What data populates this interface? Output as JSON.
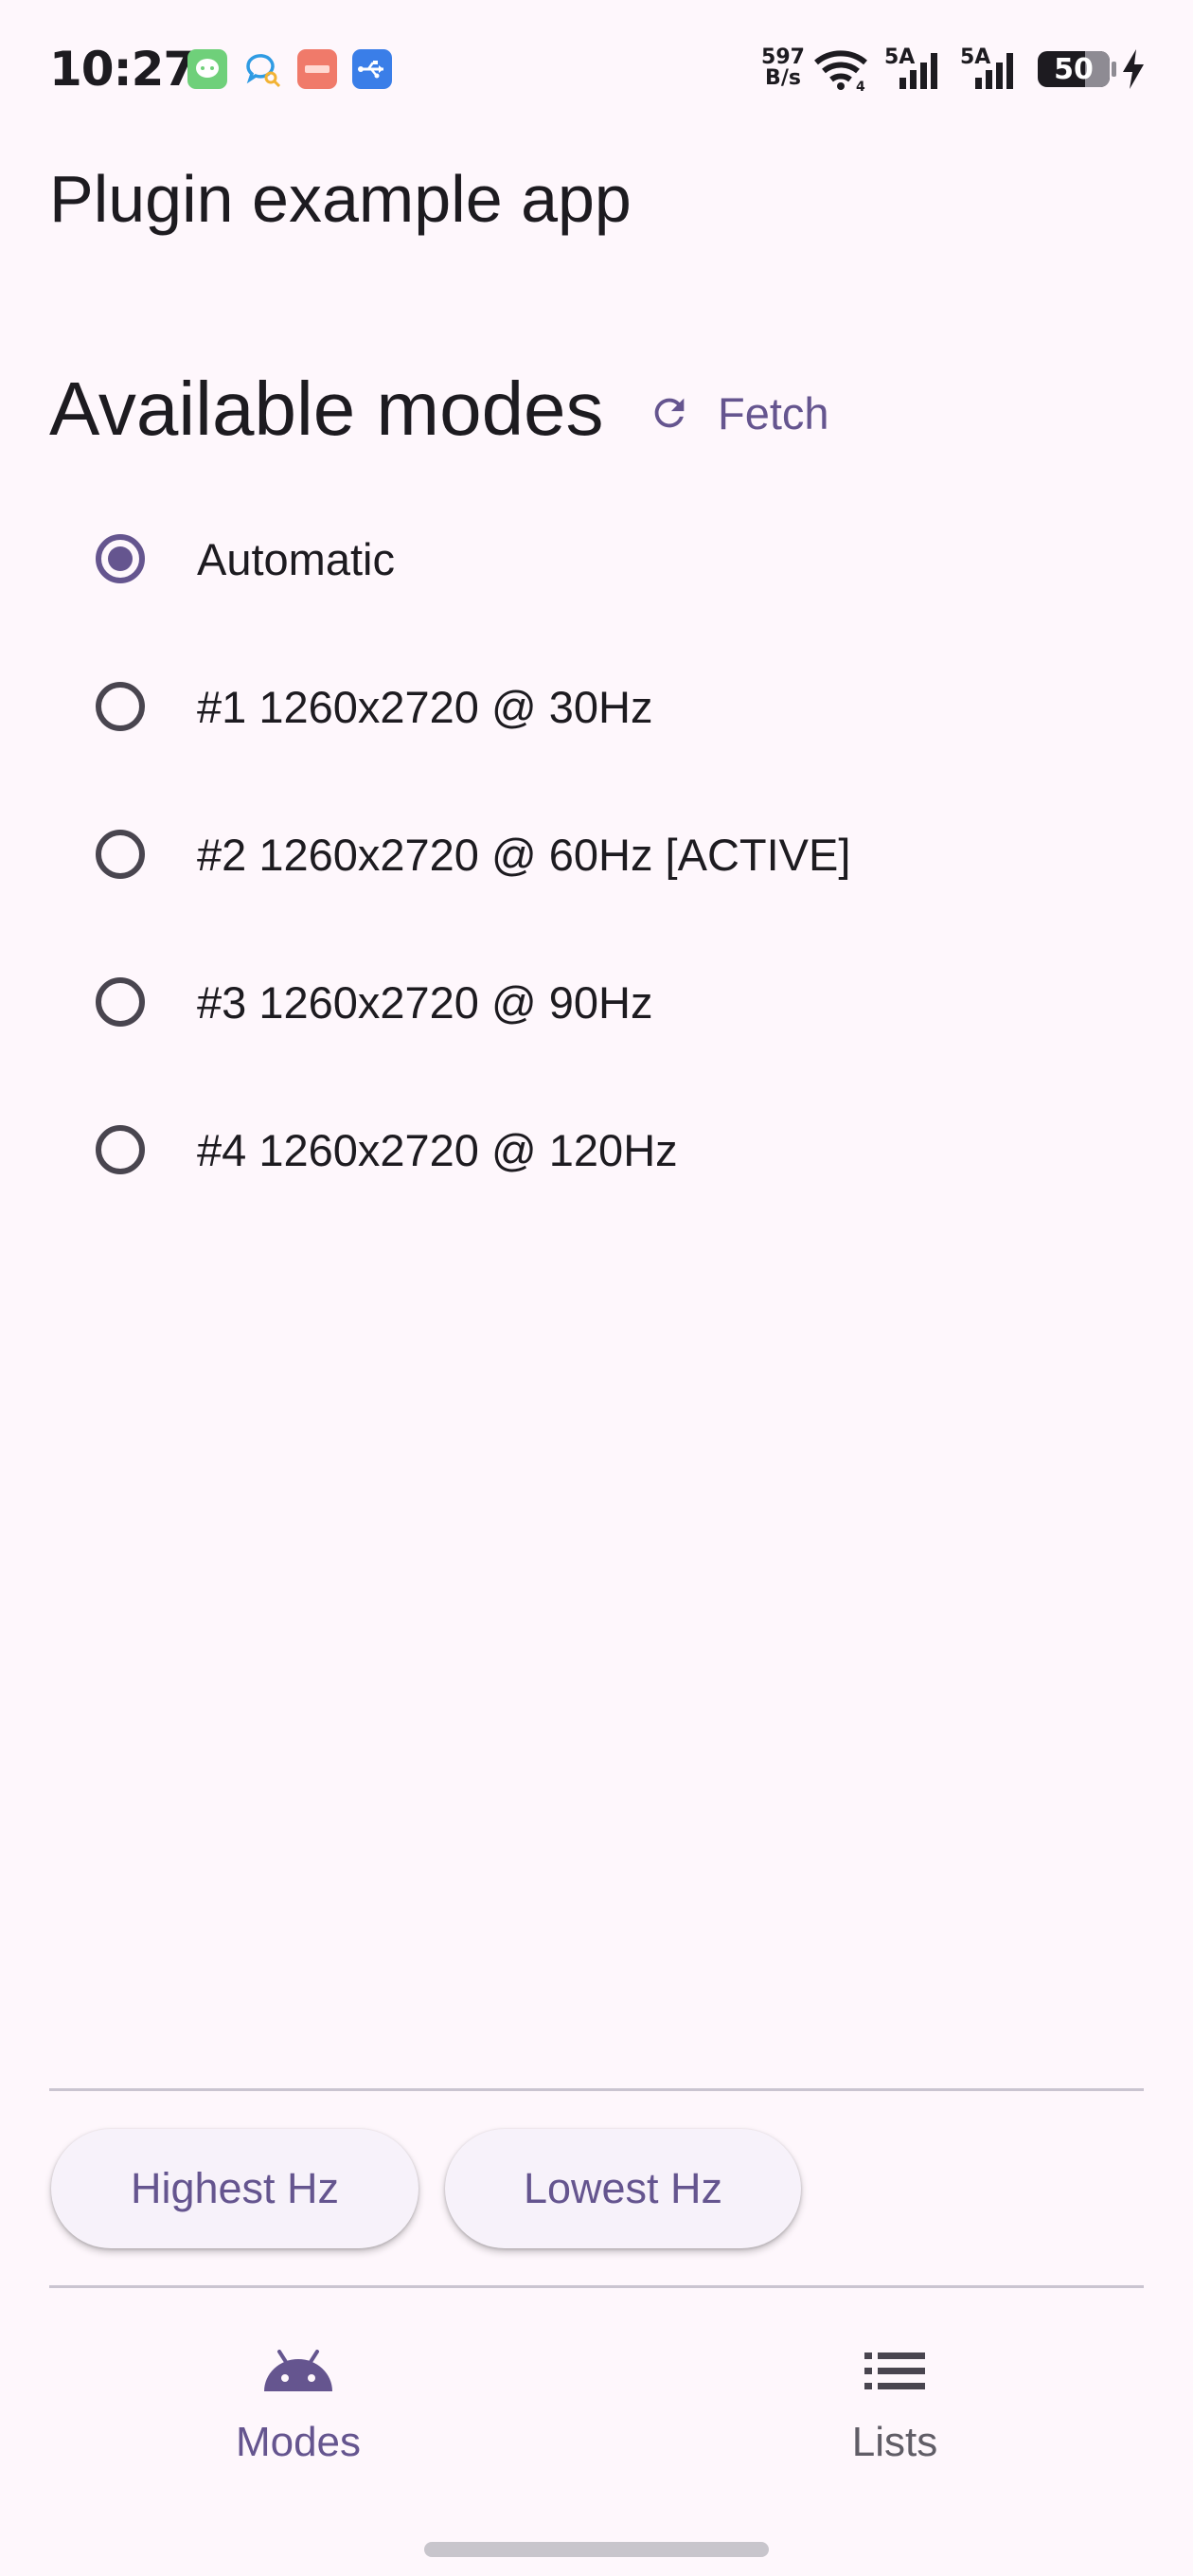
{
  "status_bar": {
    "time": "10:27",
    "net_speed_value": "597",
    "net_speed_unit": "B/s",
    "sim1_label": "5A",
    "sim2_label": "5A",
    "battery_level": "50",
    "notification_icons": [
      "chat-bubble-icon",
      "message-search-icon",
      "red-note-app-icon",
      "usb-icon"
    ],
    "notification_icon_colors": [
      "#6fd07a",
      "#2f9be3",
      "#f07a6a",
      "#3a7ee8"
    ]
  },
  "app": {
    "title": "Plugin example app"
  },
  "modes_section": {
    "title": "Available modes",
    "fetch_label": "Fetch",
    "selected_index": 0,
    "items": [
      {
        "label": "Automatic",
        "selected": true
      },
      {
        "label": "#1 1260x2720 @ 30Hz",
        "selected": false
      },
      {
        "label": "#2 1260x2720 @ 60Hz [ACTIVE]",
        "selected": false
      },
      {
        "label": "#3 1260x2720 @ 90Hz",
        "selected": false
      },
      {
        "label": "#4 1260x2720 @ 120Hz",
        "selected": false
      }
    ]
  },
  "actions": {
    "highest_label": "Highest Hz",
    "lowest_label": "Lowest Hz"
  },
  "bottom_nav": {
    "modes_label": "Modes",
    "lists_label": "Lists",
    "active": "Modes"
  },
  "colors": {
    "primary": "#65558f",
    "background": "#fef7fc",
    "on_surface": "#1d1b20",
    "outline": "#49454f"
  }
}
